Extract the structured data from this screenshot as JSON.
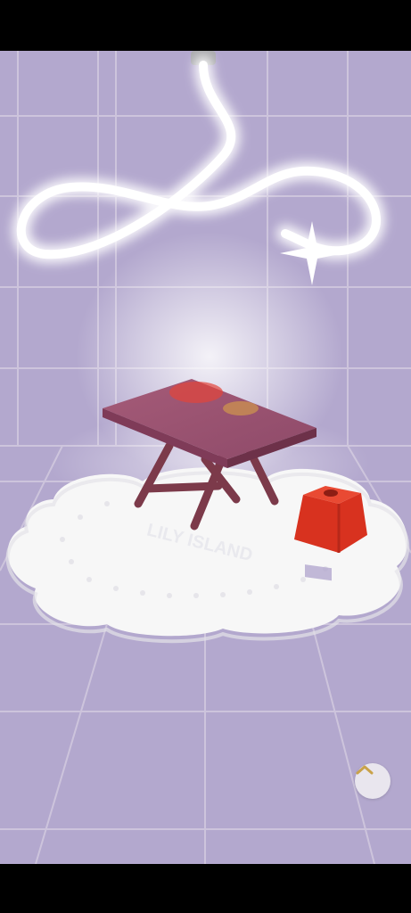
{
  "rug": {
    "text": "LILY ISLAND"
  },
  "colors": {
    "wall": "#b3a8ce",
    "grid": "#d2cadf",
    "neon": "#ffffff",
    "table_top": "#9a4e6c",
    "table_legs": "#7c3a4a",
    "stool": "#d8321f",
    "rug": "#f7f7f7",
    "button_bg": "#e9e6ee",
    "chevron": "#c9a24a"
  },
  "icons": {
    "scroll_up": "chevron-up-icon"
  }
}
